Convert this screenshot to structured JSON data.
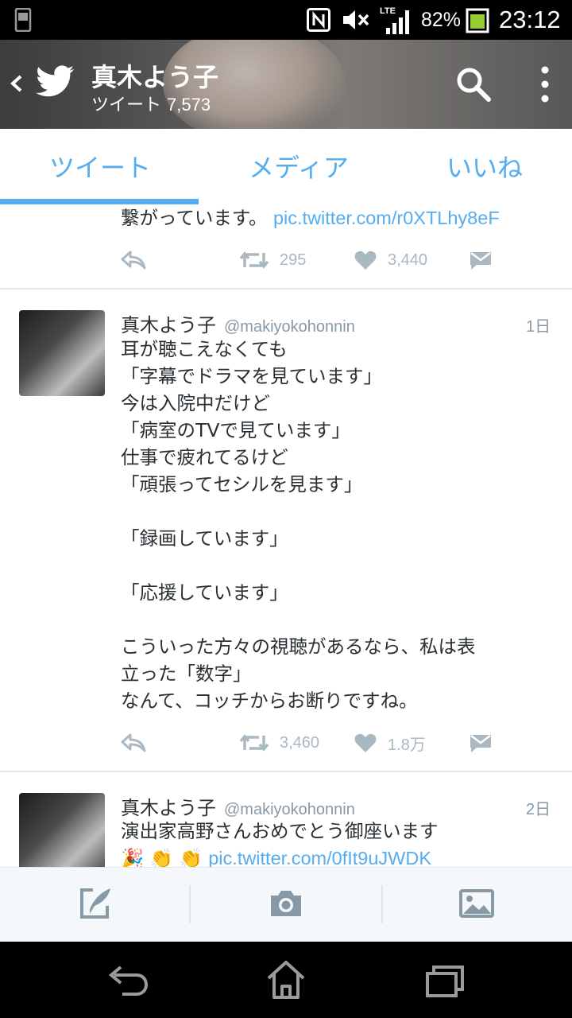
{
  "status_bar": {
    "network": "LTE",
    "battery": "82%",
    "time": "23:12",
    "icons": [
      "phone-icon",
      "nfc-icon",
      "mute-icon",
      "signal-icon",
      "battery-icon"
    ]
  },
  "header": {
    "title": "真木よう子",
    "subtitle_label": "ツイート",
    "subtitle_count": "7,573",
    "icons": [
      "back-icon",
      "twitter-bird-icon",
      "search-icon",
      "more-vertical-icon"
    ]
  },
  "tabs": [
    {
      "label": "ツイート",
      "active": true
    },
    {
      "label": "メディア",
      "active": false
    },
    {
      "label": "いいね",
      "active": false
    }
  ],
  "tweets": [
    {
      "text": "繋がっています。",
      "link": "pic.twitter.com/r0XTLhy8eF",
      "retweets": "295",
      "likes": "3,440"
    },
    {
      "name": "真木よう子",
      "handle": "@makiyokohonnin",
      "time": "1日",
      "lines": [
        "耳が聴こえなくても",
        "「字幕でドラマを見ています」",
        "今は入院中だけど",
        "「病室のTVで見ています」",
        "仕事で疲れてるけど",
        "「頑張ってセシルを見ます」",
        "",
        "「録画しています」",
        "",
        "「応援しています」",
        "",
        "こういった方々の視聴があるなら、私は表",
        "立った「数字」",
        "なんて、コッチからお断りですね。"
      ],
      "retweets": "3,460",
      "likes": "1.8万"
    },
    {
      "name": "真木よう子",
      "handle": "@makiyokohonnin",
      "time": "2日",
      "text": "演出家高野さんおめでとう御座います",
      "emoji": "🎉 👏 👏",
      "link": "pic.twitter.com/0fIt9uJWDK"
    }
  ],
  "composer": {
    "buttons": [
      "compose-tweet-icon",
      "camera-icon",
      "gallery-icon"
    ]
  },
  "navbar": {
    "buttons": [
      "back-nav-icon",
      "home-nav-icon",
      "recents-nav-icon"
    ]
  },
  "colors": {
    "accent": "#55acee",
    "text": "#292f33",
    "muted": "#8899a6",
    "action": "#aab8c2"
  }
}
